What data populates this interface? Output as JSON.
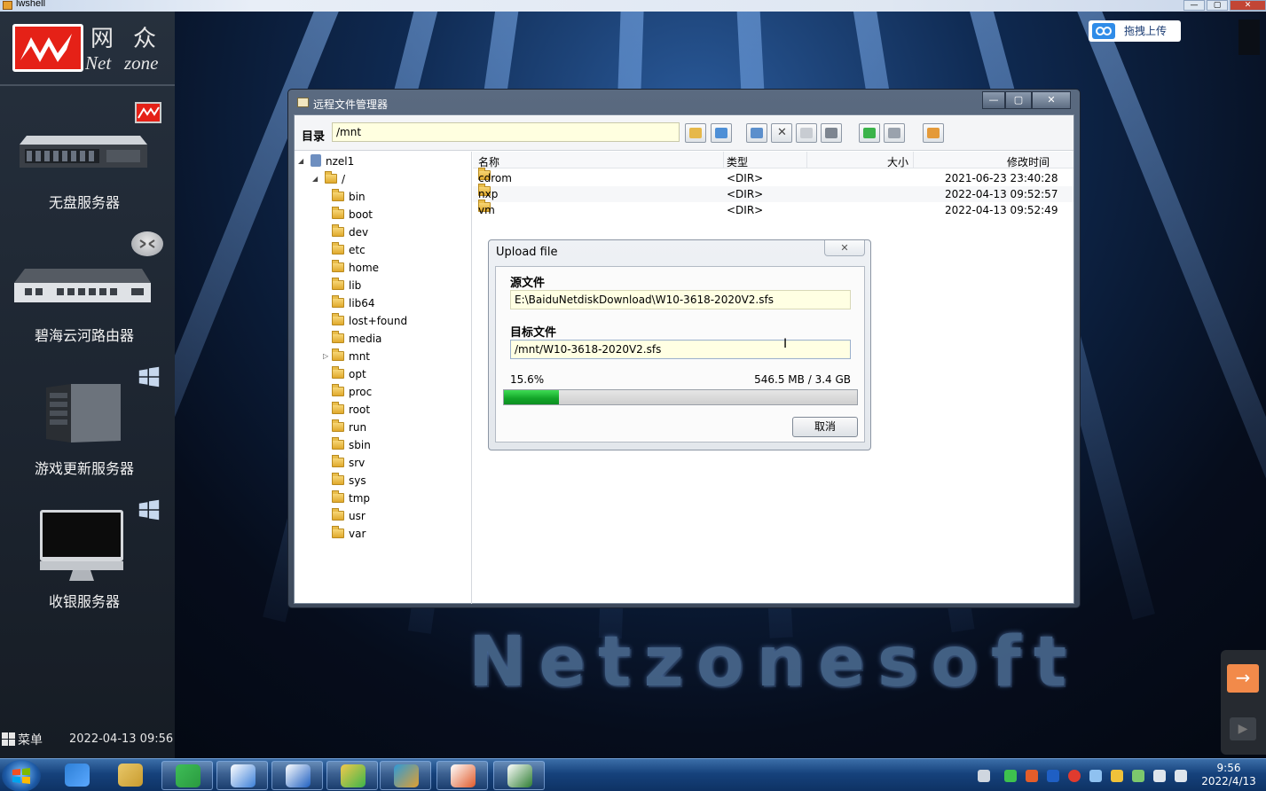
{
  "window": {
    "title": "lwshell"
  },
  "logo": {
    "cn_1": "网",
    "cn_2": "众",
    "en_1": "Net",
    "en_2": "zone"
  },
  "sidebar": {
    "items": [
      {
        "label": "无盘服务器",
        "icon": "server-rack-icon",
        "badge": "netzone-badge-icon"
      },
      {
        "label": "碧海云河路由器",
        "icon": "router-icon",
        "badge": "router-badge-icon"
      },
      {
        "label": "游戏更新服务器",
        "icon": "tower-server-icon",
        "badge": "windows-icon"
      },
      {
        "label": "收银服务器",
        "icon": "monitor-icon",
        "badge": "windows-icon"
      }
    ],
    "menu_label": "菜单",
    "datetime": "2022-04-13 09:56"
  },
  "baidu": {
    "label": "拖拽上传"
  },
  "watermark": "Netzonesoft",
  "file_manager": {
    "title": "远程文件管理器",
    "dir_label": "目录",
    "dir_value": "/mnt",
    "toolbar_icons": [
      "back-icon",
      "refresh-icon",
      "new-folder-icon",
      "delete-icon",
      "rename-icon",
      "edit-icon",
      "upload-icon",
      "download-icon",
      "archive-icon"
    ],
    "tree": {
      "host": "nzel1",
      "root": "/",
      "folders": [
        "bin",
        "boot",
        "dev",
        "etc",
        "home",
        "lib",
        "lib64",
        "lost+found",
        "media",
        "mnt",
        "opt",
        "proc",
        "root",
        "run",
        "sbin",
        "srv",
        "sys",
        "tmp",
        "usr",
        "var"
      ],
      "selected": "mnt"
    },
    "columns": {
      "name": "名称",
      "type": "类型",
      "size": "大小",
      "modified": "修改时间"
    },
    "rows": [
      {
        "name": "cdrom",
        "type": "<DIR>",
        "size": "",
        "modified": "2021-06-23 23:40:28"
      },
      {
        "name": "nxp",
        "type": "<DIR>",
        "size": "",
        "modified": "2022-04-13 09:52:57"
      },
      {
        "name": "vm",
        "type": "<DIR>",
        "size": "",
        "modified": "2022-04-13 09:52:49"
      }
    ]
  },
  "upload": {
    "title": "Upload file",
    "source_label": "源文件",
    "source_value": "E:\\BaiduNetdiskDownload\\W10-3618-2020V2.sfs",
    "target_label": "目标文件",
    "target_value": "/mnt/W10-3618-2020V2.sfs",
    "percent_text": "15.6%",
    "progress_fraction": 0.156,
    "size_text": "546.5 MB / 3.4 GB",
    "cancel_label": "取消"
  },
  "taskbar": {
    "apps": [
      "ie-icon",
      "explorer-icon",
      "360-browser-icon",
      "baidu-netdisk-icon",
      "remote-desktop-icon",
      "wechat-icon",
      "lwshell-icon",
      "office-icon",
      "presentation-icon"
    ],
    "clock_time": "9:56",
    "clock_date": "2022/4/13"
  },
  "colors": {
    "accent": "#12a428",
    "brand_red": "#e52117",
    "folder": "#e0a92c",
    "input_bg": "#ffffe0"
  }
}
